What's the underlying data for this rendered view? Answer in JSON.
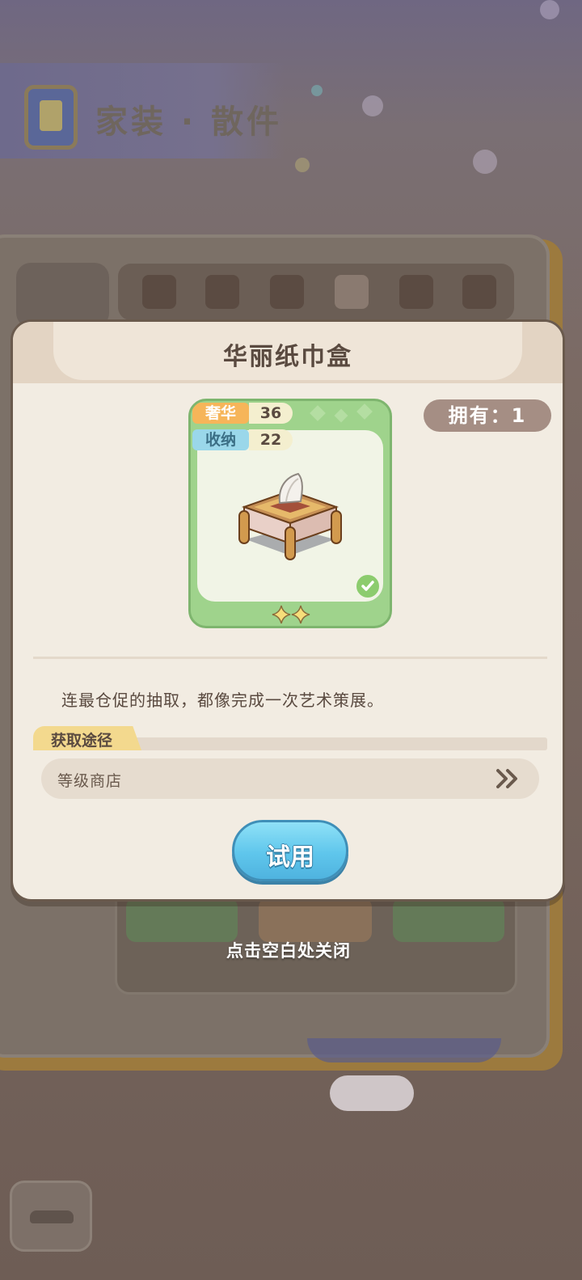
{
  "background": {
    "header_title": "家装 · 散件"
  },
  "dialog": {
    "title": "华丽纸巾盒",
    "owned_label": "拥有：1",
    "stats": [
      {
        "label": "奢华",
        "value": "36"
      },
      {
        "label": "收纳",
        "value": "22"
      }
    ],
    "description": "连最仓促的抽取，都像完成一次艺术策展。",
    "source_section_label": "获取途径",
    "source_item": "等级商店",
    "try_button_label": "试用"
  },
  "close_hint": "点击空白处关闭",
  "colors": {
    "card_green": "#9fd38c",
    "luxury_tag": "#f6b559",
    "storage_tag": "#9ad7ea",
    "try_button": "#5fc6ec",
    "owned_badge": "#a58e84"
  }
}
